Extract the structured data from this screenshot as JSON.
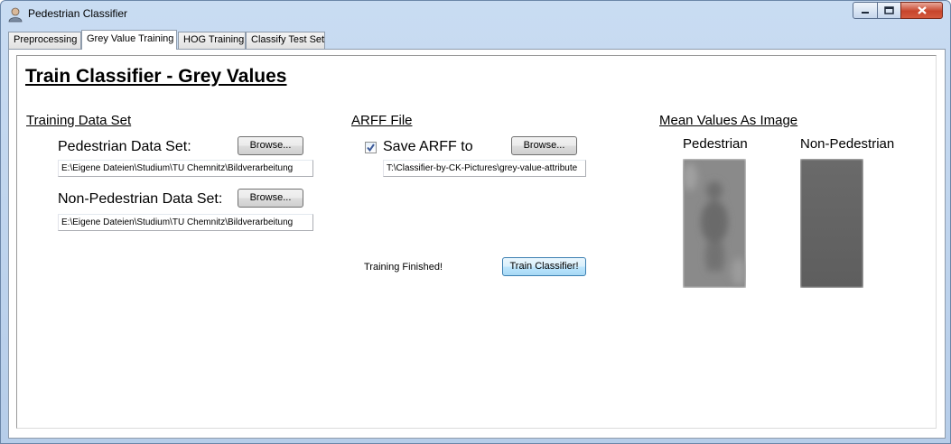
{
  "window": {
    "title": "Pedestrian Classifier"
  },
  "tabs": [
    {
      "label": "Preprocessing"
    },
    {
      "label": "Grey Value Training"
    },
    {
      "label": "HOG Training"
    },
    {
      "label": "Classify Test Set"
    }
  ],
  "active_tab": "Grey Value Training",
  "page": {
    "title": "Train Classifier - Grey Values"
  },
  "training": {
    "heading": "Training Data Set",
    "pedestrian_label": "Pedestrian Data Set:",
    "pedestrian_path": "E:\\Eigene Dateien\\Studium\\TU Chemnitz\\Bildverarbeitung",
    "nonpedestrian_label": "Non-Pedestrian Data Set:",
    "nonpedestrian_path": "E:\\Eigene Dateien\\Studium\\TU Chemnitz\\Bildverarbeitung",
    "browse_label": "Browse..."
  },
  "arff": {
    "heading": "ARFF File",
    "save_label": "Save ARFF to",
    "save_checked": true,
    "path": "T:\\Classifier-by-CK-Pictures\\grey-value-attribute",
    "browse_label": "Browse...",
    "status": "Training Finished!",
    "train_button": "Train Classifier!"
  },
  "mean_values": {
    "heading": "Mean Values As Image",
    "pedestrian_label": "Pedestrian",
    "nonpedestrian_label": "Non-Pedestrian"
  },
  "colors": {
    "title_bar": "#c9dcf2",
    "close_button": "#c7452c",
    "focus_button": "#3c7fb1"
  }
}
